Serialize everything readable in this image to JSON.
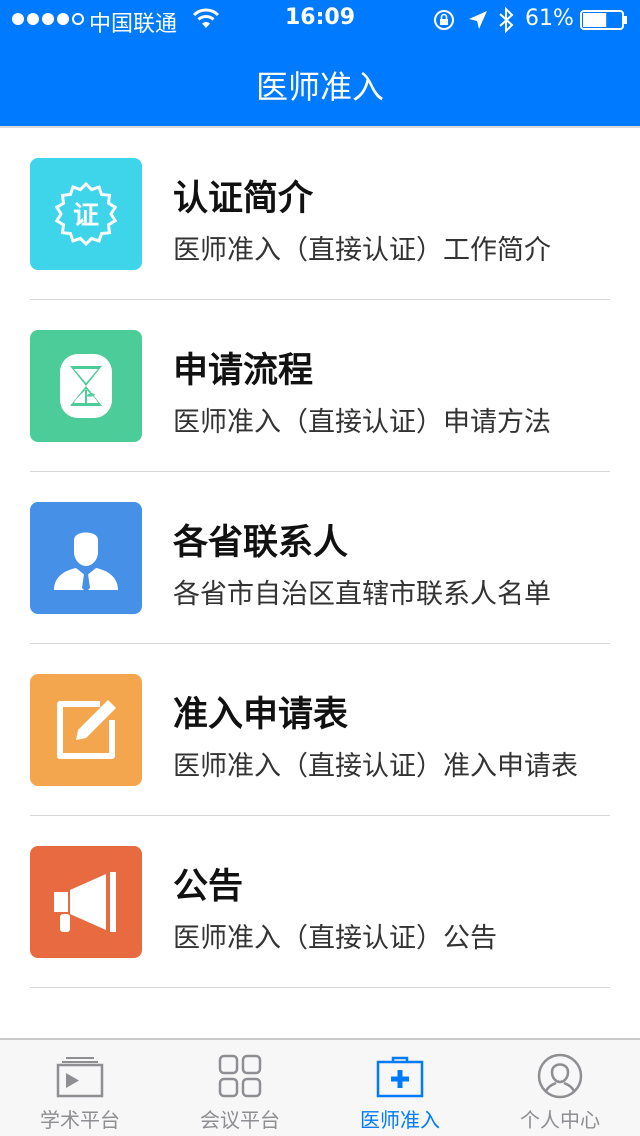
{
  "status_bar": {
    "carrier": "中国联通",
    "time": "16:09",
    "battery_percent": "61%",
    "battery_level": 0.61
  },
  "header": {
    "title": "医师准入"
  },
  "items": [
    {
      "title": "认证简介",
      "subtitle": "医师准入（直接认证）工作简介",
      "icon": "certificate-badge-icon",
      "color": "#3ed5ea"
    },
    {
      "title": "申请流程",
      "subtitle": "医师准入（直接认证）申请方法",
      "icon": "hourglass-icon",
      "color": "#4ccc98"
    },
    {
      "title": "各省联系人",
      "subtitle": "各省市自治区直辖市联系人名单",
      "icon": "contact-person-icon",
      "color": "#4690e8"
    },
    {
      "title": "准入申请表",
      "subtitle": "医师准入（直接认证）准入申请表",
      "icon": "edit-form-icon",
      "color": "#f4a64f"
    },
    {
      "title": "公告",
      "subtitle": "医师准入（直接认证）公告",
      "icon": "megaphone-icon",
      "color": "#e86a40"
    }
  ],
  "certificate_glyph": "证",
  "tabs": [
    {
      "label": "学术平台",
      "icon": "video-play-icon",
      "active": false
    },
    {
      "label": "会议平台",
      "icon": "grid-icon",
      "active": false
    },
    {
      "label": "医师准入",
      "icon": "medical-kit-icon",
      "active": true
    },
    {
      "label": "个人中心",
      "icon": "user-circle-icon",
      "active": false
    }
  ],
  "colors": {
    "brand": "#007aff",
    "tab_inactive": "#8e8e93"
  }
}
